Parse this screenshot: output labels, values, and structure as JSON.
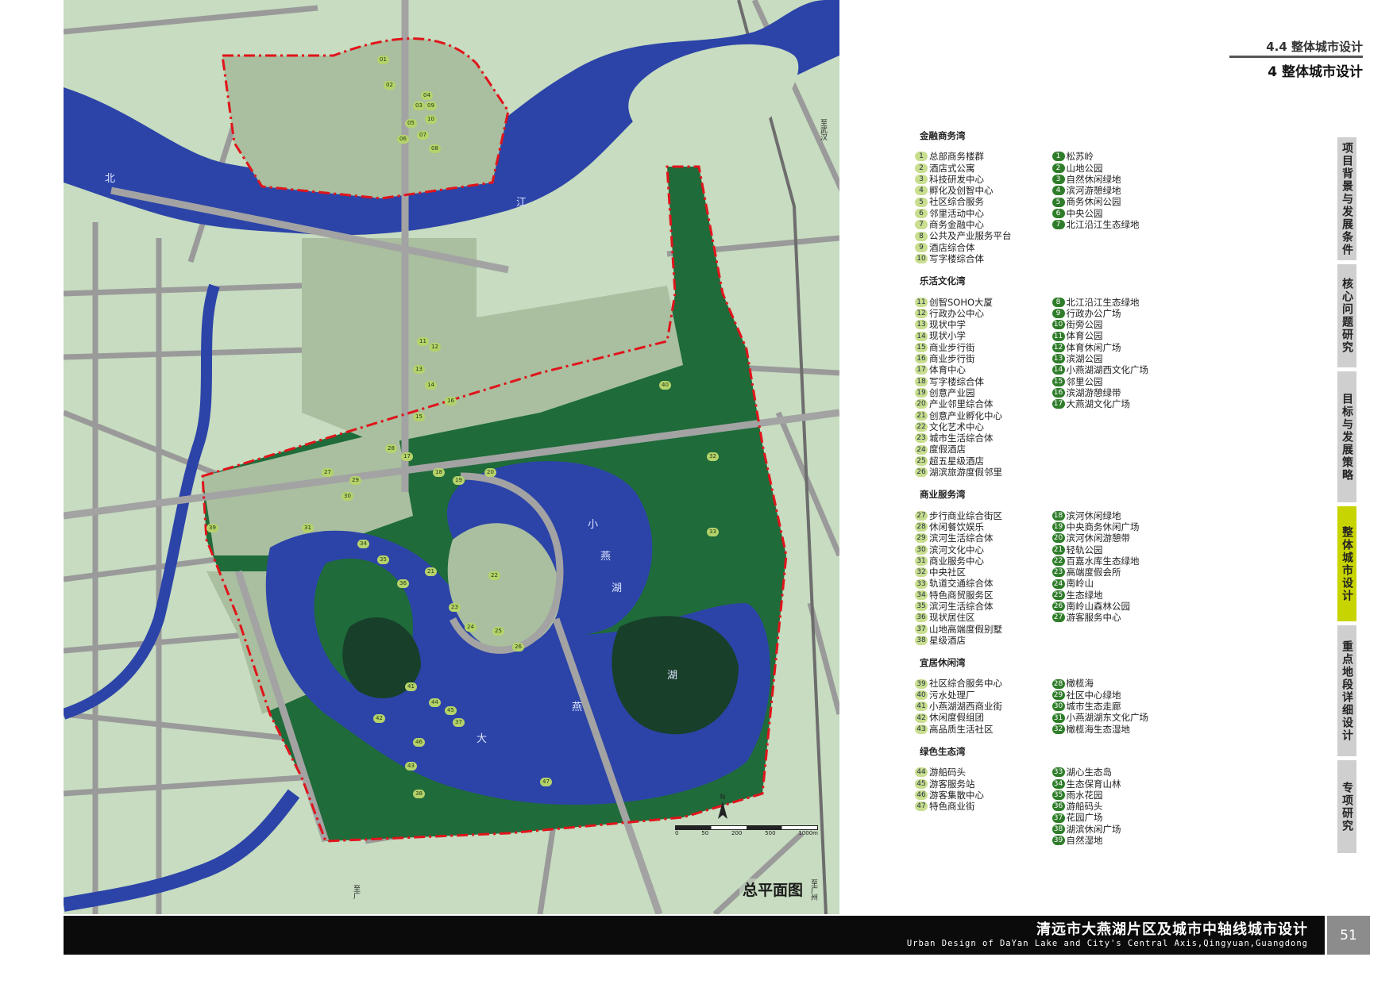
{
  "header": {
    "sub_title": "4.4 整体城市设计",
    "main_title": "4 整体城市设计"
  },
  "map": {
    "title": "总平面图",
    "north_label": "N",
    "scale_labels": [
      "0",
      "50",
      "200",
      "500",
      "1000m"
    ],
    "road_labels": [
      "至武汉",
      "至广州",
      "至广"
    ],
    "river_labels": [
      "北",
      "江"
    ],
    "lake_labels": [
      "小",
      "燕",
      "湖",
      "大",
      "燕",
      "湖"
    ],
    "markers": [
      "01",
      "02",
      "03",
      "04",
      "05",
      "06",
      "07",
      "08",
      "09",
      "10",
      "11",
      "12",
      "13",
      "14",
      "15",
      "16",
      "17",
      "18",
      "19",
      "20",
      "21",
      "22",
      "23",
      "24",
      "25",
      "26",
      "27",
      "28",
      "29",
      "30",
      "31",
      "32",
      "33",
      "34",
      "35",
      "36",
      "37",
      "38",
      "39",
      "40",
      "41",
      "42",
      "43",
      "44",
      "45",
      "46",
      "47"
    ],
    "colors": {
      "land": "#c7dcc0",
      "water": "#2c44a8",
      "green": "#1f6b3a",
      "road": "#9a9a9a",
      "boundary": "#e0141b"
    }
  },
  "legend": {
    "sections": [
      {
        "title": "金融商务湾",
        "left": [
          {
            "n": "1",
            "label": "总部商务楼群"
          },
          {
            "n": "2",
            "label": "酒店式公寓"
          },
          {
            "n": "3",
            "label": "科技研发中心"
          },
          {
            "n": "4",
            "label": "孵化及创智中心"
          },
          {
            "n": "5",
            "label": "社区综合服务"
          },
          {
            "n": "6",
            "label": "邻里活动中心"
          },
          {
            "n": "7",
            "label": "商务金融中心"
          },
          {
            "n": "8",
            "label": "公共及产业服务平台"
          },
          {
            "n": "9",
            "label": "酒店综合体"
          },
          {
            "n": "10",
            "label": "写字楼综合体"
          }
        ],
        "right": [
          {
            "n": "1",
            "label": "松苏岭"
          },
          {
            "n": "2",
            "label": "山地公园"
          },
          {
            "n": "3",
            "label": "自然休闲绿地"
          },
          {
            "n": "4",
            "label": "滨河游憩绿地"
          },
          {
            "n": "5",
            "label": "商务休闲公园"
          },
          {
            "n": "6",
            "label": "中央公园"
          },
          {
            "n": "7",
            "label": "北江沿江生态绿地"
          }
        ]
      },
      {
        "title": "乐活文化湾",
        "left": [
          {
            "n": "11",
            "label": "创智SOHO大厦"
          },
          {
            "n": "12",
            "label": "行政办公中心"
          },
          {
            "n": "13",
            "label": "现状中学"
          },
          {
            "n": "14",
            "label": "现状小学"
          },
          {
            "n": "15",
            "label": "商业步行街"
          },
          {
            "n": "16",
            "label": "商业步行街"
          },
          {
            "n": "17",
            "label": "体育中心"
          },
          {
            "n": "18",
            "label": "写字楼综合体"
          },
          {
            "n": "19",
            "label": "创意产业园"
          },
          {
            "n": "20",
            "label": "产业邻里综合体"
          },
          {
            "n": "21",
            "label": "创意产业孵化中心"
          },
          {
            "n": "22",
            "label": "文化艺术中心"
          },
          {
            "n": "23",
            "label": "城市生活综合体"
          },
          {
            "n": "24",
            "label": "度假酒店"
          },
          {
            "n": "25",
            "label": "超五星级酒店"
          },
          {
            "n": "26",
            "label": "湖滨旅游度假邻里"
          }
        ],
        "right": [
          {
            "n": "8",
            "label": "北江沿江生态绿地"
          },
          {
            "n": "9",
            "label": "行政办公广场"
          },
          {
            "n": "10",
            "label": "街旁公园"
          },
          {
            "n": "11",
            "label": "体育公园"
          },
          {
            "n": "12",
            "label": "体育休闲广场"
          },
          {
            "n": "13",
            "label": "滨湖公园"
          },
          {
            "n": "14",
            "label": "小燕湖湖西文化广场"
          },
          {
            "n": "15",
            "label": "邻里公园"
          },
          {
            "n": "16",
            "label": "滨湖游憩绿带"
          },
          {
            "n": "17",
            "label": "大燕湖文化广场"
          }
        ]
      },
      {
        "title": "商业服务湾",
        "left": [
          {
            "n": "27",
            "label": "步行商业综合街区"
          },
          {
            "n": "28",
            "label": "休闲餐饮娱乐"
          },
          {
            "n": "29",
            "label": "滨河生活综合体"
          },
          {
            "n": "30",
            "label": "滨河文化中心"
          },
          {
            "n": "31",
            "label": "商业服务中心"
          },
          {
            "n": "32",
            "label": "中央社区"
          },
          {
            "n": "33",
            "label": "轨道交通综合体"
          },
          {
            "n": "34",
            "label": "特色商贸服务区"
          },
          {
            "n": "35",
            "label": "滨河生活综合体"
          },
          {
            "n": "36",
            "label": "现状居住区"
          },
          {
            "n": "37",
            "label": "山地高端度假别墅"
          },
          {
            "n": "38",
            "label": "星级酒店"
          }
        ],
        "right": [
          {
            "n": "18",
            "label": "滨河休闲绿地"
          },
          {
            "n": "19",
            "label": "中央商务休闲广场"
          },
          {
            "n": "20",
            "label": "滨河休闲游憩带"
          },
          {
            "n": "21",
            "label": "轻轨公园"
          },
          {
            "n": "22",
            "label": "百嘉水库生态绿地"
          },
          {
            "n": "23",
            "label": "高端度假会所"
          },
          {
            "n": "24",
            "label": "南岭山"
          },
          {
            "n": "25",
            "label": "生态绿地"
          },
          {
            "n": "26",
            "label": "南岭山森林公园"
          },
          {
            "n": "27",
            "label": "游客服务中心"
          }
        ]
      },
      {
        "title": "宜居休闲湾",
        "left": [
          {
            "n": "39",
            "label": "社区综合服务中心"
          },
          {
            "n": "40",
            "label": "污水处理厂"
          },
          {
            "n": "41",
            "label": "小燕湖湖西商业街"
          },
          {
            "n": "42",
            "label": "休闲度假组团"
          },
          {
            "n": "43",
            "label": "高品质生活社区"
          }
        ],
        "right": [
          {
            "n": "28",
            "label": "橄榄海"
          },
          {
            "n": "29",
            "label": "社区中心绿地"
          },
          {
            "n": "30",
            "label": "城市生态走廊"
          },
          {
            "n": "31",
            "label": "小燕湖湖东文化广场"
          },
          {
            "n": "32",
            "label": "橄榄海生态湿地"
          }
        ]
      },
      {
        "title": "绿色生态湾",
        "left": [
          {
            "n": "44",
            "label": "游船码头"
          },
          {
            "n": "45",
            "label": "游客服务站"
          },
          {
            "n": "46",
            "label": "游客集散中心"
          },
          {
            "n": "47",
            "label": "特色商业街"
          }
        ],
        "right": [
          {
            "n": "33",
            "label": "湖心生态岛"
          },
          {
            "n": "34",
            "label": "生态保育山林"
          },
          {
            "n": "35",
            "label": "雨水花园"
          },
          {
            "n": "36",
            "label": "游船码头"
          },
          {
            "n": "37",
            "label": "花园广场"
          },
          {
            "n": "38",
            "label": "湖滨休闲广场"
          },
          {
            "n": "39",
            "label": "自然湿地"
          }
        ]
      }
    ]
  },
  "nav_tabs": [
    {
      "label": "项目背景与发展条件",
      "active": false
    },
    {
      "label": "核心问题研究",
      "active": false
    },
    {
      "label": "目标与发展策略",
      "active": false
    },
    {
      "label": "整体城市设计",
      "active": true
    },
    {
      "label": "重点地段详细设计",
      "active": false
    },
    {
      "label": "专项研究",
      "active": false
    }
  ],
  "footer": {
    "title_cn": "清远市大燕湖片区及城市中轴线城市设计",
    "title_en": "Urban Design of DaYan Lake and City's Central Axis,Qingyuan,Guangdong",
    "page_number": "51"
  }
}
